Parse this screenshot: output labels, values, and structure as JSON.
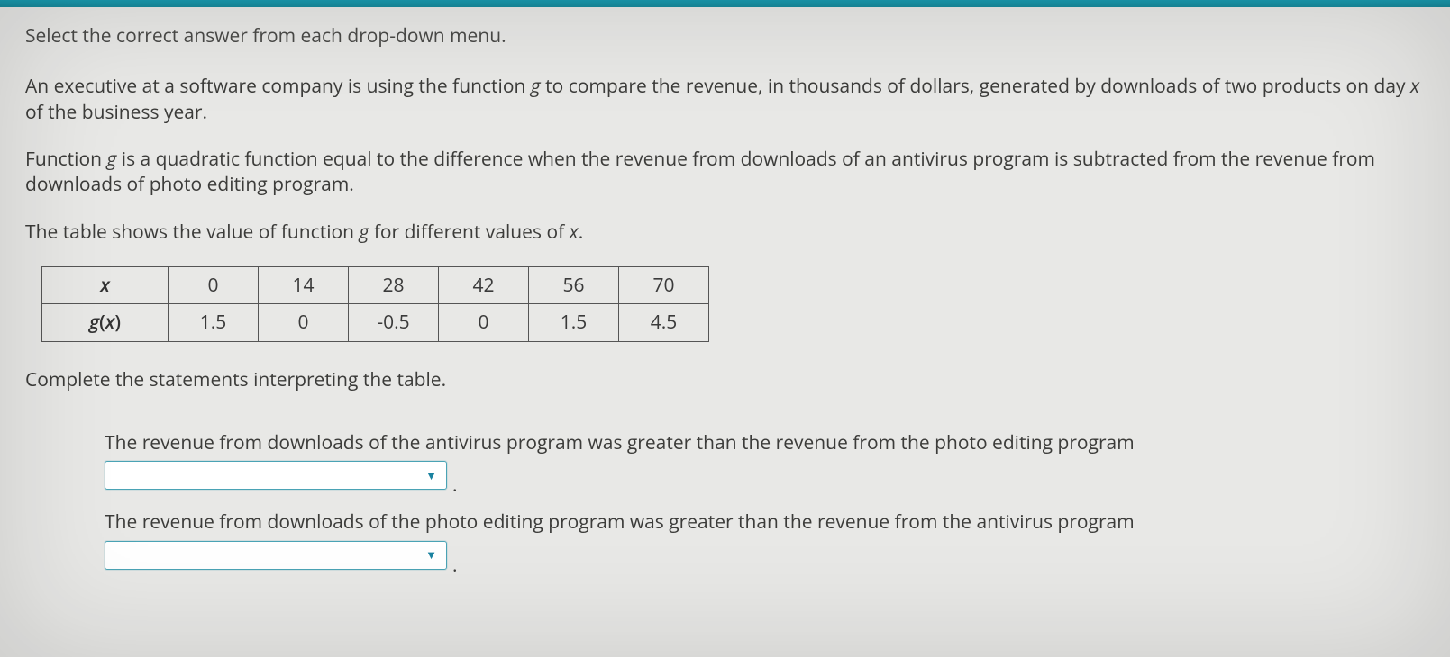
{
  "instruction": "Select the correct answer from each drop-down menu.",
  "para1_a": "An executive at a software company is using the function ",
  "para1_g": "g",
  "para1_b": " to compare the revenue, in thousands of dollars, generated by downloads of two products on day ",
  "para1_x": "x",
  "para1_c": " of the business year.",
  "para2_a": "Function ",
  "para2_g": "g",
  "para2_b": " is a quadratic function equal to the difference when the revenue from downloads of an antivirus program is subtracted from the revenue from downloads of photo editing program.",
  "para3_a": "The table shows the value of function ",
  "para3_g": "g",
  "para3_b": " for different values of ",
  "para3_x": "x",
  "para3_c": ".",
  "table": {
    "row1_label": "x",
    "row2_label_a": "g",
    "row2_label_b": "(",
    "row2_label_c": "x",
    "row2_label_d": ")",
    "r1": [
      "0",
      "14",
      "28",
      "42",
      "56",
      "70"
    ],
    "r2": [
      "1.5",
      "0",
      "-0.5",
      "0",
      "1.5",
      "4.5"
    ]
  },
  "complete": "Complete the statements interpreting the table.",
  "stmt1": "The revenue from downloads of the antivirus program was greater than the revenue from the photo editing program",
  "stmt2": "The revenue from downloads of the photo editing program was greater than the revenue from the antivirus program",
  "period": "."
}
